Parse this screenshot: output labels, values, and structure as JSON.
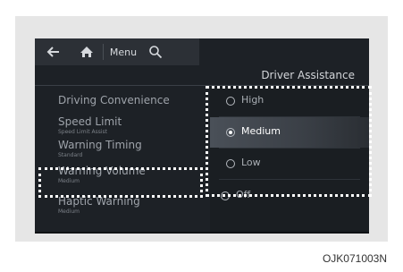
{
  "toolbar": {
    "back_icon": "arrow-left-icon",
    "home_icon": "home-icon",
    "menu_label": "Menu",
    "search_icon": "search-icon"
  },
  "header": {
    "title": "Driver Assistance"
  },
  "menu": {
    "items": [
      {
        "label": "Driving Convenience",
        "sub": ""
      },
      {
        "label": "Speed Limit",
        "sub": "Speed Limit Assist"
      },
      {
        "label": "Warning Timing",
        "sub": "Standard"
      },
      {
        "label": "Warning Volume",
        "sub": "Medium"
      },
      {
        "label": "Haptic Warning",
        "sub": "Medium"
      }
    ]
  },
  "options": {
    "items": [
      {
        "label": "High",
        "selected": false
      },
      {
        "label": "Medium",
        "selected": true
      },
      {
        "label": "Low",
        "selected": false
      },
      {
        "label": "Off",
        "selected": false
      }
    ]
  },
  "caption": "OJK071003N",
  "colors": {
    "highlight_border": "#ffffff",
    "screen_bg": "#1d2126"
  }
}
